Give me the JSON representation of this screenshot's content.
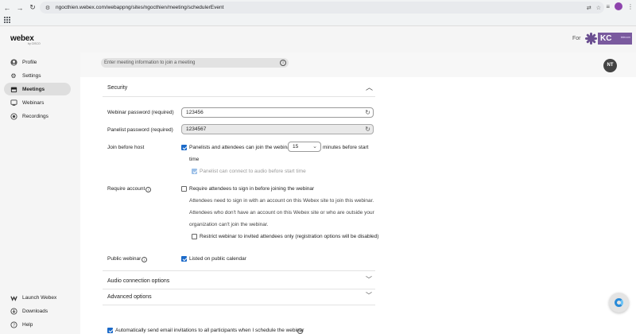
{
  "browser": {
    "url": "ngocthien.webex.com/webappng/sites/ngocthien/meeting/schedulerEvent"
  },
  "header": {
    "logo_text": "webex",
    "logo_sub": "by CISCO",
    "for_label": "For",
    "partner_logo_text": "KC",
    "partner_logo_sub": "telecom"
  },
  "search": {
    "placeholder": "Enter meeting information to join a meeting"
  },
  "avatar": {
    "initials": "NT"
  },
  "sidebar": {
    "items": [
      {
        "label": "Profile",
        "icon": "user-circle-icon"
      },
      {
        "label": "Settings",
        "icon": "gear-icon"
      },
      {
        "label": "Meetings",
        "icon": "calendar-icon",
        "active": true
      },
      {
        "label": "Webinars",
        "icon": "webinar-icon"
      },
      {
        "label": "Recordings",
        "icon": "record-icon"
      }
    ],
    "bottom": [
      {
        "label": "Launch Webex",
        "icon": "webex-icon"
      },
      {
        "label": "Downloads",
        "icon": "download-icon"
      },
      {
        "label": "Help",
        "icon": "help-icon"
      }
    ]
  },
  "security": {
    "title": "Security",
    "webinar_password_label": "Webinar password (required)",
    "webinar_password_value": "123456",
    "panelist_password_label": "Panelist password (required)",
    "panelist_password_value": "1234567",
    "join_before_host_label": "Join before host",
    "jbh_text_before": "Panelists and attendees can join the webinar",
    "jbh_minutes": "15",
    "jbh_text_after": "minutes before start",
    "jbh_text_wrap": "time",
    "jbh_audio_text": "Panelist can connect to audio before start time",
    "require_account_label": "Require account",
    "require_account_checkbox": "Require attendees to sign in before joining the webinar",
    "require_account_desc1": "Attendees need to sign in with an account on this Webex site to join this webinar.",
    "require_account_desc2": "Attendees who don't have an account on this Webex site or who are outside your",
    "require_account_desc3": "organization can't join the webinar.",
    "restrict_text": "Restrict webinar to invited attendees only (registration options will be disabled)",
    "public_webinar_label": "Public webinar",
    "public_webinar_checkbox": "Listed on public calendar"
  },
  "sections": {
    "audio_title": "Audio connection options",
    "advanced_title": "Advanced options"
  },
  "footer": {
    "auto_send_text": "Automatically send email invitations to all participants when I schedule the webinar"
  },
  "colors": {
    "accent": "#1b6ac9",
    "sidebar_bg": "#f5f5f5",
    "active_item_bg": "#dedede"
  }
}
